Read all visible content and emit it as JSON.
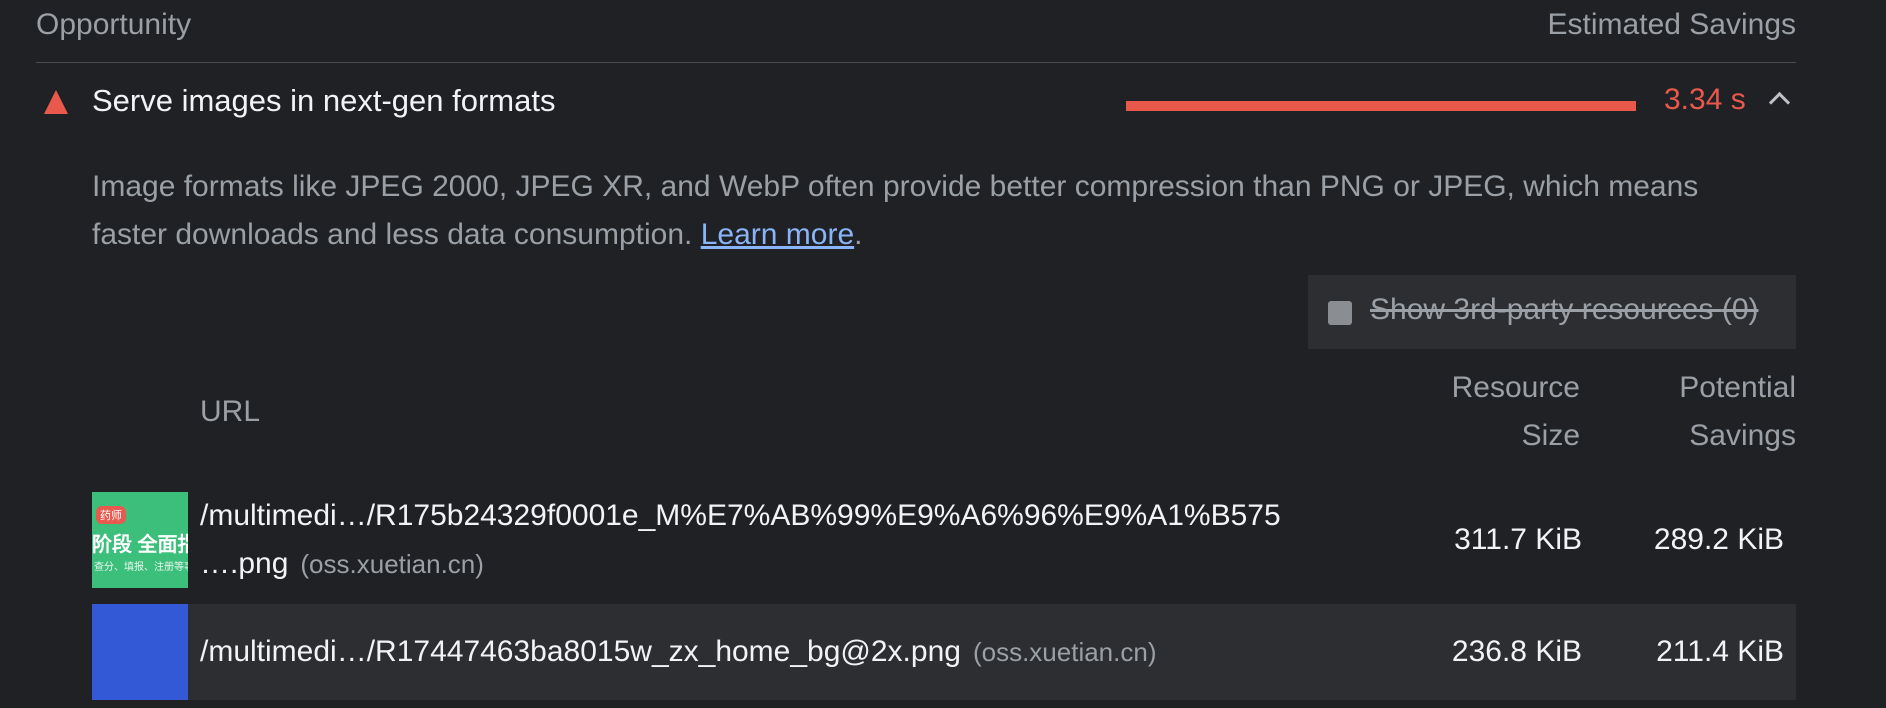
{
  "header": {
    "left_label": "Opportunity",
    "right_label": "Estimated Savings"
  },
  "audit": {
    "title": "Serve images in next-gen formats",
    "savings": "3.34 s",
    "savings_fraction": 1.0,
    "status_color": "#e9594b",
    "icon": "warning-triangle-icon",
    "description_text": "Image formats like JPEG 2000, JPEG XR, and WebP often provide better compression than PNG or JPEG, which means faster downloads and less data consumption.",
    "learn_more": "Learn more",
    "description_end": "."
  },
  "third_party": {
    "label": "Show 3rd-party resources",
    "count": "(0)",
    "checked": false
  },
  "table": {
    "columns": {
      "url": "URL",
      "size_line1": "Resource",
      "size_line2": "Size",
      "savings_line1": "Potential",
      "savings_line2": "Savings"
    },
    "rows": [
      {
        "url": "/multimedi…/R175b24329f0001e_M%E7%AB%99%E9%A6%96%E9%A1%B575 ….png",
        "host": "(oss.xuetian.cn)",
        "size": "311.7 KiB",
        "savings": "289.2 KiB",
        "thumb_badge": "药师",
        "thumb_title": "阶段 全面指",
        "thumb_caption": "查分、填报、注册等事项"
      },
      {
        "url": "/multimedi…/R17447463ba8015w_zx_home_bg@2x.png",
        "host": "(oss.xuetian.cn)",
        "size": "236.8 KiB",
        "savings": "211.4 KiB"
      }
    ]
  }
}
